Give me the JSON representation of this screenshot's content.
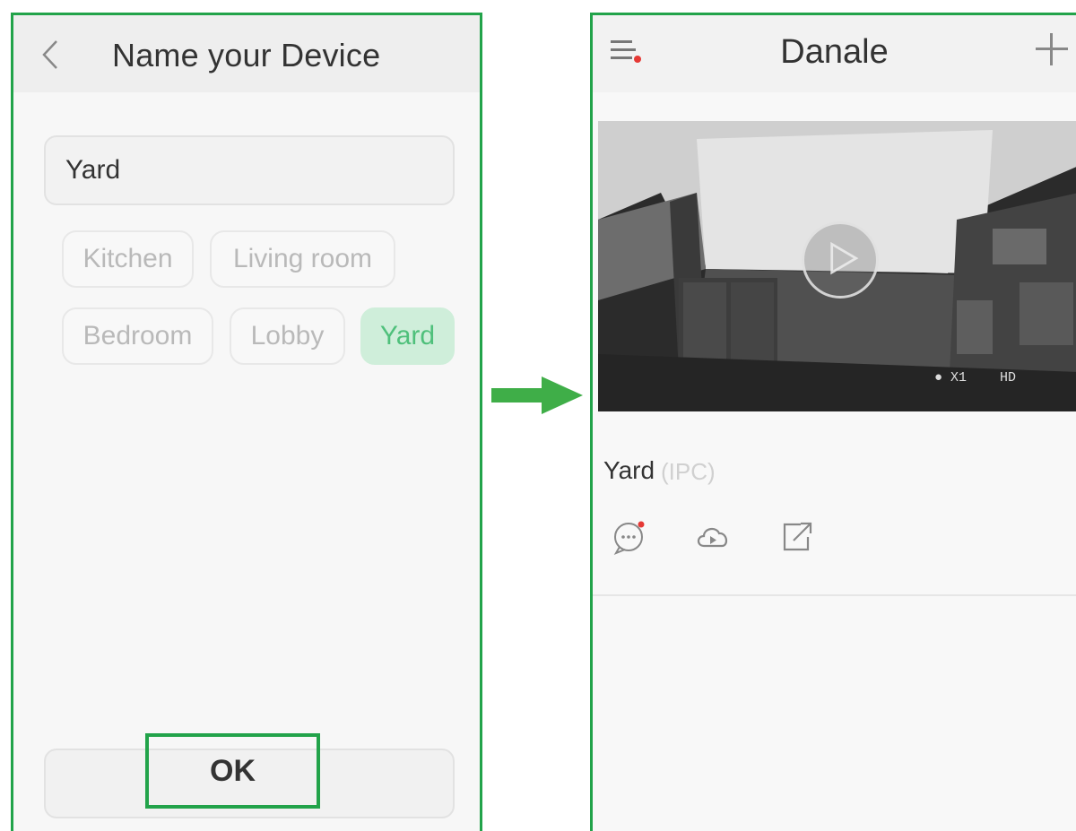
{
  "left_screen": {
    "title": "Name your Device",
    "name_input_value": "Yard",
    "name_input_placeholder": "",
    "chips": [
      "Kitchen",
      "Living room",
      "Bedroom",
      "Lobby",
      "Yard"
    ],
    "selected_chip": "Yard",
    "ok_label": "OK"
  },
  "right_screen": {
    "title": "Danale",
    "device": {
      "name": "Yard",
      "type": "(IPC)"
    },
    "video_overlay": {
      "top_left": "",
      "zoom": "X1",
      "quality": "HD",
      "timestamp": ""
    }
  },
  "colors": {
    "accent_green": "#22a34a",
    "chip_selected_bg": "#cfeeda",
    "chip_selected_text": "#4fc07b",
    "notification_dot": "#e53935"
  },
  "icons": {
    "back": "chevron-left-icon",
    "menu": "menu-icon",
    "add": "plus-icon",
    "play": "play-icon",
    "message": "message-icon",
    "cloud": "cloud-play-icon",
    "share": "share-icon",
    "arrow": "right-arrow-icon"
  }
}
